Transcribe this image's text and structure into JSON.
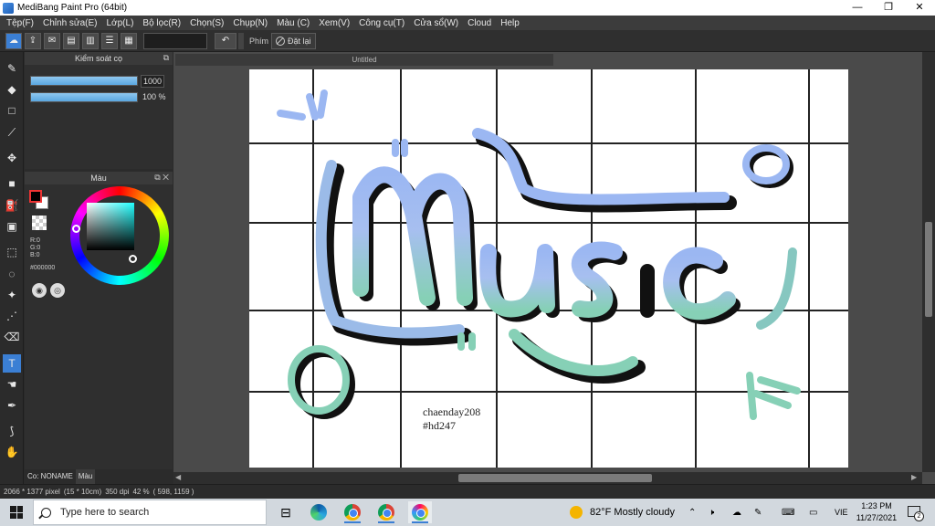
{
  "window": {
    "title": "MediBang Paint Pro (64bit)",
    "minimize": "—",
    "maximize": "❐",
    "close": "✕"
  },
  "menu": [
    "Tệp(F)",
    "Chỉnh sửa(E)",
    "Lớp(L)",
    "Bộ lọc(R)",
    "Chọn(S)",
    "Chụp(N)",
    "Màu (C)",
    "Xem(V)",
    "Công cụ(T)",
    "Cửa sổ(W)",
    "Cloud",
    "Help"
  ],
  "toolbar": {
    "shortcut_label": "Phím",
    "reset_label": "Đặt lại"
  },
  "brush_panel": {
    "title": "Kiểm soát cọ",
    "size_value": "1000",
    "size_fraction": 1.0,
    "opacity_value": "100 %",
    "opacity_fraction": 1.0
  },
  "color_panel": {
    "title": "Màu",
    "r": "R:0",
    "g": "G:0",
    "b": "B:0",
    "hex": "#000000",
    "primary_color": "#000000",
    "secondary_color": "#ffffff"
  },
  "bottom_tabs": {
    "brush_tab": "Co: NONAME",
    "color_tab": "Màu"
  },
  "document": {
    "tab_title": "Untitled",
    "credit_line1": "chaenday208",
    "credit_line2": "#hd247",
    "artwork_word": "Music"
  },
  "status": {
    "dimensions": "2066 * 1377 pixel",
    "physical": "(15 * 10cm)",
    "dpi": "350 dpi",
    "zoom": "42 %",
    "cursor": "( 598, 1159 )"
  },
  "taskbar": {
    "search_placeholder": "Type here to search",
    "weather": "82°F  Mostly cloudy",
    "language": "VIE",
    "time": "1:23 PM",
    "date": "11/27/2021",
    "notifications": "2"
  }
}
